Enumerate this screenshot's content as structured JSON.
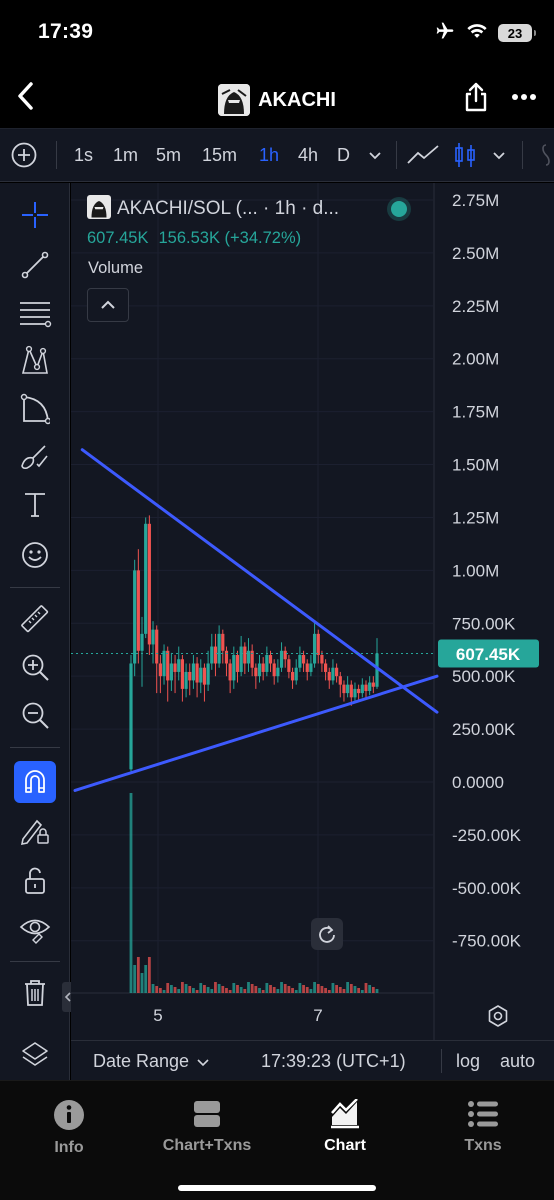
{
  "status_bar": {
    "time": "17:39",
    "battery": "23"
  },
  "header": {
    "title": "AKACHI"
  },
  "toolbar": {
    "intervals": [
      "1s",
      "1m",
      "5m",
      "15m",
      "1h",
      "4h",
      "D"
    ],
    "selected_interval": "1h"
  },
  "legend": {
    "title": "AKACHI/SOL (... · 1h · d...",
    "last_value": "607.45K",
    "change": "156.53K (+34.72%)",
    "volume_label": "Volume"
  },
  "info_bar": {
    "date_range": "Date Range",
    "clock": "17:39:23 (UTC+1)",
    "log": "log",
    "auto": "auto"
  },
  "tabs": [
    {
      "label": "Info"
    },
    {
      "label": "Chart+Txns"
    },
    {
      "label": "Chart"
    },
    {
      "label": "Txns"
    }
  ],
  "active_tab": "Chart",
  "colors": {
    "up": "#26a69a",
    "down": "#ef5350",
    "accent": "#2962ff",
    "trendline": "#3d5afe",
    "background": "#131722"
  },
  "chart_data": {
    "type": "candlestick",
    "price_axis_labels": [
      "2.75M",
      "2.50M",
      "2.25M",
      "2.00M",
      "1.75M",
      "1.50M",
      "1.25M",
      "1.00M",
      "750.00K",
      "500.00K",
      "250.00K",
      "0.0000",
      "-250.00K",
      "-500.00K",
      "-750.00K"
    ],
    "price_axis_values": [
      2750000,
      2500000,
      2250000,
      2000000,
      1750000,
      1500000,
      1250000,
      1000000,
      750000,
      500000,
      250000,
      0,
      -250000,
      -500000,
      -750000
    ],
    "time_axis_labels": [
      "5",
      "7"
    ],
    "last_price_label": "607.45K",
    "last_price": 607450,
    "ylim": [
      -1000000,
      2850000
    ],
    "trendlines": [
      {
        "from": [
          0.02,
          1570000
        ],
        "to": [
          1.0,
          330000
        ]
      },
      {
        "from": [
          0.0,
          -40000
        ],
        "to": [
          1.0,
          500000
        ]
      }
    ],
    "candles_series": [
      {
        "name": "early",
        "values": [
          [
            60000,
            560000,
            50000,
            600000
          ],
          [
            560000,
            1000000,
            500000,
            1050000
          ],
          [
            1000000,
            620000,
            560000,
            1100000
          ],
          [
            620000,
            700000,
            450000,
            780000
          ],
          [
            700000,
            1220000,
            680000,
            1250000
          ],
          [
            1220000,
            650000,
            600000,
            1260000
          ],
          [
            650000,
            720000,
            560000,
            760000
          ],
          [
            720000,
            560000,
            420000,
            740000
          ],
          [
            560000,
            500000,
            420000,
            600000
          ],
          [
            500000,
            620000,
            460000,
            650000
          ],
          [
            620000,
            480000,
            380000,
            640000
          ],
          [
            480000,
            560000,
            430000,
            610000
          ]
        ]
      },
      {
        "name": "main",
        "values": [
          [
            560000,
            520000,
            420000,
            600000
          ],
          [
            520000,
            580000,
            480000,
            640000
          ],
          [
            580000,
            440000,
            380000,
            600000
          ],
          [
            440000,
            520000,
            400000,
            560000
          ],
          [
            520000,
            480000,
            410000,
            560000
          ],
          [
            480000,
            560000,
            440000,
            600000
          ],
          [
            560000,
            470000,
            400000,
            590000
          ],
          [
            470000,
            540000,
            420000,
            580000
          ],
          [
            540000,
            460000,
            380000,
            560000
          ],
          [
            460000,
            560000,
            430000,
            620000
          ],
          [
            560000,
            640000,
            530000,
            700000
          ],
          [
            640000,
            560000,
            500000,
            700000
          ],
          [
            560000,
            700000,
            540000,
            740000
          ],
          [
            700000,
            620000,
            560000,
            720000
          ],
          [
            620000,
            560000,
            500000,
            640000
          ],
          [
            560000,
            480000,
            420000,
            580000
          ],
          [
            480000,
            600000,
            440000,
            640000
          ],
          [
            600000,
            520000,
            470000,
            620000
          ],
          [
            520000,
            640000,
            500000,
            690000
          ],
          [
            640000,
            560000,
            510000,
            660000
          ],
          [
            560000,
            620000,
            520000,
            680000
          ],
          [
            620000,
            540000,
            500000,
            650000
          ],
          [
            540000,
            500000,
            440000,
            560000
          ],
          [
            500000,
            560000,
            470000,
            600000
          ],
          [
            560000,
            520000,
            480000,
            590000
          ],
          [
            520000,
            600000,
            500000,
            640000
          ],
          [
            600000,
            560000,
            520000,
            620000
          ],
          [
            560000,
            500000,
            460000,
            580000
          ],
          [
            500000,
            540000,
            470000,
            580000
          ],
          [
            540000,
            620000,
            520000,
            660000
          ],
          [
            620000,
            580000,
            540000,
            640000
          ],
          [
            580000,
            520000,
            490000,
            600000
          ],
          [
            520000,
            480000,
            440000,
            540000
          ],
          [
            480000,
            540000,
            460000,
            580000
          ],
          [
            540000,
            600000,
            520000,
            640000
          ],
          [
            600000,
            560000,
            520000,
            620000
          ],
          [
            560000,
            520000,
            480000,
            580000
          ],
          [
            520000,
            560000,
            500000,
            600000
          ],
          [
            560000,
            700000,
            540000,
            760000
          ],
          [
            700000,
            600000,
            560000,
            720000
          ],
          [
            600000,
            560000,
            520000,
            620000
          ],
          [
            560000,
            520000,
            480000,
            580000
          ],
          [
            520000,
            480000,
            440000,
            540000
          ],
          [
            480000,
            540000,
            460000,
            580000
          ],
          [
            540000,
            500000,
            470000,
            560000
          ],
          [
            500000,
            460000,
            400000,
            520000
          ],
          [
            460000,
            420000,
            380000,
            480000
          ],
          [
            420000,
            460000,
            400000,
            500000
          ],
          [
            460000,
            400000,
            360000,
            480000
          ],
          [
            400000,
            440000,
            380000,
            470000
          ],
          [
            440000,
            420000,
            380000,
            460000
          ],
          [
            420000,
            460000,
            400000,
            490000
          ],
          [
            460000,
            430000,
            390000,
            480000
          ],
          [
            430000,
            470000,
            410000,
            500000
          ],
          [
            470000,
            450000,
            420000,
            500000
          ],
          [
            450000,
            607450,
            440000,
            680000
          ]
        ]
      }
    ]
  }
}
